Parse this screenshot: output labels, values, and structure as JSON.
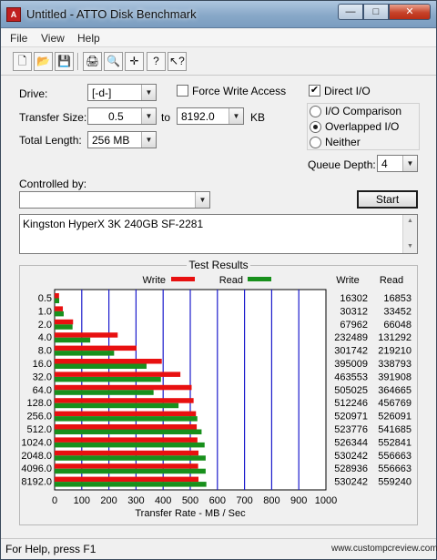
{
  "window": {
    "title": "Untitled - ATTO Disk Benchmark",
    "minimize_glyph": "—",
    "maximize_glyph": "□",
    "close_glyph": "✕"
  },
  "menu": {
    "items": [
      "File",
      "View",
      "Help"
    ]
  },
  "toolbar": {
    "buttons": [
      "new-file-icon",
      "open-folder-icon",
      "save-icon",
      "print-icon",
      "print-preview-icon",
      "move-icon",
      "help-icon",
      "context-help-icon"
    ],
    "glyphs": [
      "🗋",
      "📂",
      "💾",
      "🖨",
      "🔍",
      "✛",
      "?",
      "↖?"
    ]
  },
  "form": {
    "drive_label": "Drive:",
    "drive_value": "[-d-]",
    "force_write_label": "Force Write Access",
    "force_write_checked": false,
    "transfer_size_label": "Transfer Size:",
    "transfer_from": "0.5",
    "to_label": "to",
    "transfer_to": "8192.0",
    "transfer_unit": "KB",
    "total_length_label": "Total Length:",
    "total_length_value": "256 MB",
    "direct_io_label": "Direct I/O",
    "direct_io_checked": true,
    "io_options": [
      {
        "label": "I/O Comparison",
        "selected": false
      },
      {
        "label": "Overlapped I/O",
        "selected": true
      },
      {
        "label": "Neither",
        "selected": false
      }
    ],
    "queue_depth_label": "Queue Depth:",
    "queue_depth_value": "4",
    "controlled_by_label": "Controlled by:",
    "controlled_by_value": "",
    "start_label": "Start",
    "description": "Kingston HyperX 3K 240GB SF-2281"
  },
  "results": {
    "title": "Test Results",
    "write_col": "Write",
    "read_col": "Read"
  },
  "chart_data": {
    "type": "bar",
    "orientation": "horizontal",
    "title": "Test Results",
    "xlabel": "Transfer Rate - MB / Sec",
    "xlim": [
      0,
      1000
    ],
    "xticks": [
      "0",
      "100",
      "200",
      "300",
      "400",
      "500",
      "600",
      "700",
      "800",
      "900",
      "1000"
    ],
    "grid": true,
    "legend_placement": "top",
    "categories": [
      "0.5",
      "1.0",
      "2.0",
      "4.0",
      "8.0",
      "16.0",
      "32.0",
      "64.0",
      "128.0",
      "256.0",
      "512.0",
      "1024.0",
      "2048.0",
      "4096.0",
      "8192.0"
    ],
    "series": [
      {
        "name": "Write",
        "color": "#e81010",
        "values": [
          16302,
          30312,
          67962,
          232489,
          301742,
          395009,
          463553,
          505025,
          512246,
          520971,
          523776,
          526344,
          530242,
          528936,
          530242
        ]
      },
      {
        "name": "Read",
        "color": "#18901c",
        "values": [
          16853,
          33452,
          66048,
          131292,
          219210,
          338793,
          391908,
          364665,
          456769,
          526091,
          541685,
          552841,
          556663,
          556663,
          559240
        ]
      }
    ],
    "value_unit_divisor_to_axis": 1000
  },
  "status": {
    "text": "For Help, press F1",
    "watermark": "www.custompcreview.com"
  }
}
